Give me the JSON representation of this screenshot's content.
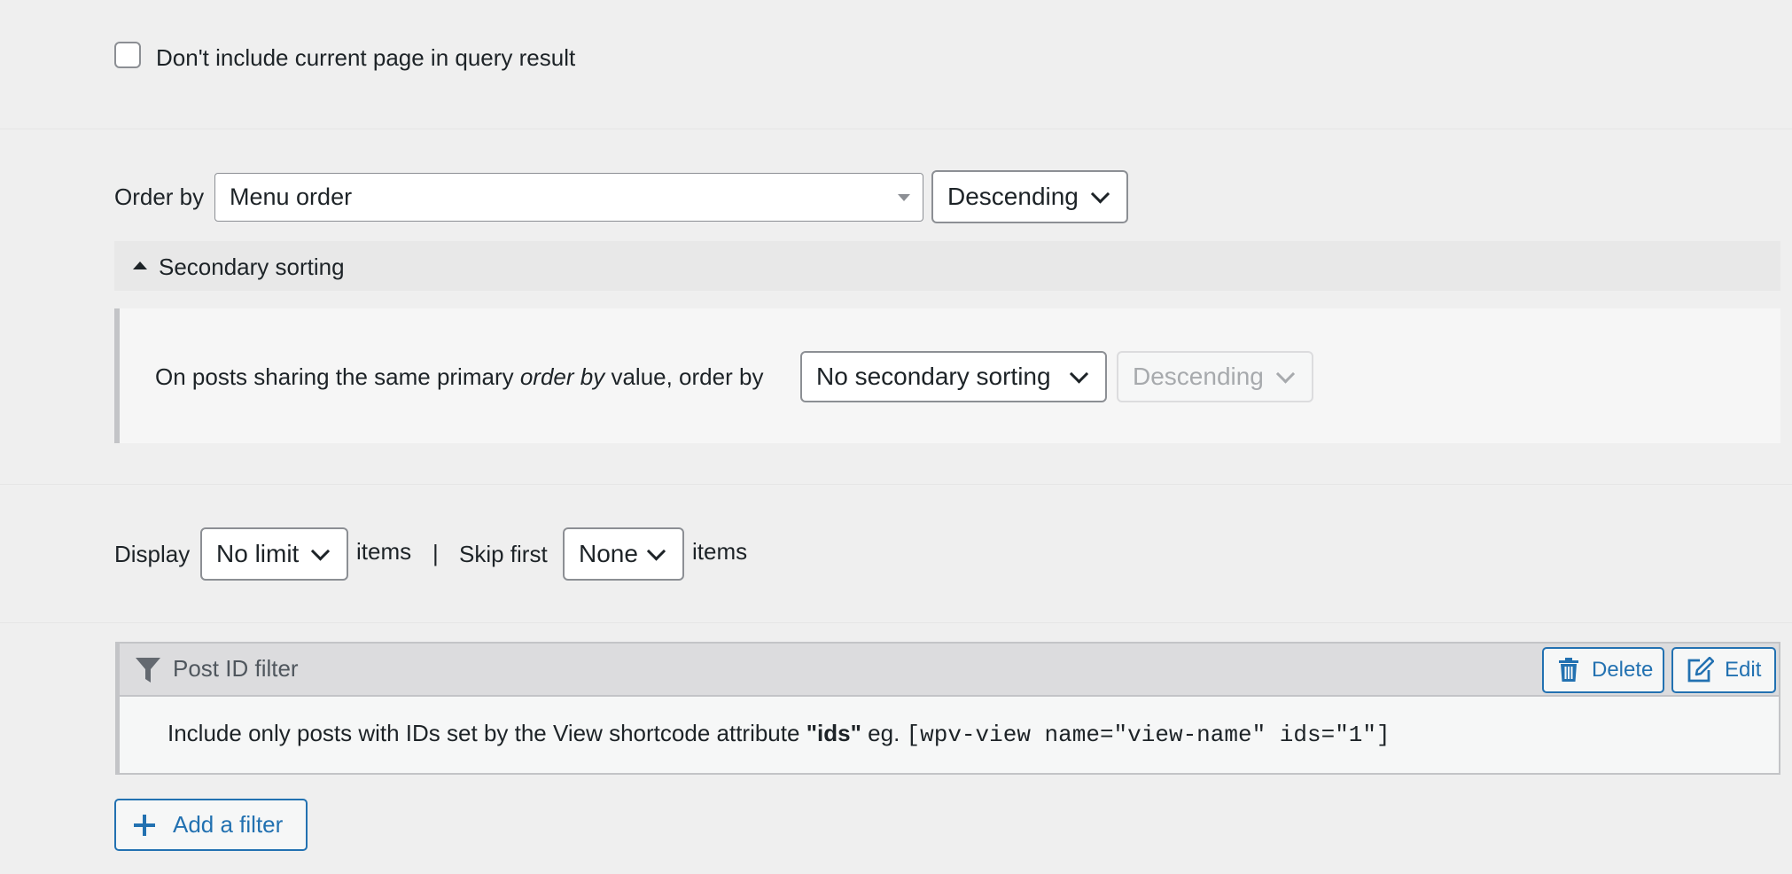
{
  "exclude_current": {
    "label": "Don't include current page in query result",
    "checked": false
  },
  "order": {
    "label": "Order by",
    "field_value": "Menu order",
    "direction_value": "Descending"
  },
  "secondary": {
    "toggle_label": "Secondary sorting",
    "text_before": "On posts sharing the same primary ",
    "text_emphasis": "order by",
    "text_after": " value, order by",
    "field_value": "No secondary sorting",
    "direction_value": "Descending"
  },
  "limit": {
    "display_label": "Display",
    "display_value": "No limit",
    "items_label_1": "items",
    "separator": "|",
    "skip_label": "Skip first",
    "skip_value": "None",
    "items_label_2": "items"
  },
  "filter": {
    "title": "Post ID filter",
    "delete_label": "Delete",
    "edit_label": "Edit",
    "desc_before": "Include only posts with IDs set by the View shortcode attribute ",
    "desc_bold": "\"ids\"",
    "desc_middle": " eg. ",
    "desc_code": "[wpv-view name=\"view-name\" ids=\"1\"]"
  },
  "add_filter": {
    "label": "Add a filter"
  },
  "colors": {
    "background": "#efefef",
    "accent": "#2271b1",
    "text": "#1d2327",
    "disabled_text": "#a7aaad"
  }
}
